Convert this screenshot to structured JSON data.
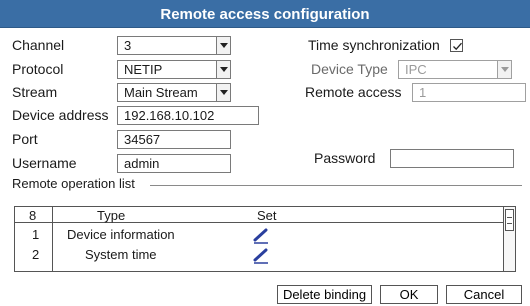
{
  "dialog": {
    "title": "Remote access configuration"
  },
  "form": {
    "channel": {
      "label": "Channel",
      "value": "3"
    },
    "protocol": {
      "label": "Protocol",
      "value": "NETIP"
    },
    "stream": {
      "label": "Stream",
      "value": "Main Stream"
    },
    "device_address": {
      "label": "Device address",
      "value": "192.168.10.102"
    },
    "port": {
      "label": "Port",
      "value": "34567"
    },
    "username": {
      "label": "Username",
      "value": "admin"
    },
    "time_sync": {
      "label": "Time synchronization",
      "checked": true
    },
    "device_type": {
      "label": "Device Type",
      "value": "IPC"
    },
    "remote_access": {
      "label": "Remote access",
      "value": "1"
    },
    "password": {
      "label": "Password",
      "value": ""
    }
  },
  "remote_operation": {
    "section_label": "Remote operation list",
    "headers": {
      "count": "8",
      "type": "Type",
      "set": "Set"
    },
    "rows": [
      {
        "index": "1",
        "type": "Device information",
        "set_icon": "pen-icon"
      },
      {
        "index": "2",
        "type": "System time",
        "set_icon": "pen-icon"
      }
    ]
  },
  "buttons": {
    "delete_binding": "Delete binding",
    "ok": "OK",
    "cancel": "Cancel"
  },
  "colors": {
    "titlebar": "#3a6ea5",
    "pen_icon": "#2a3f9e"
  }
}
